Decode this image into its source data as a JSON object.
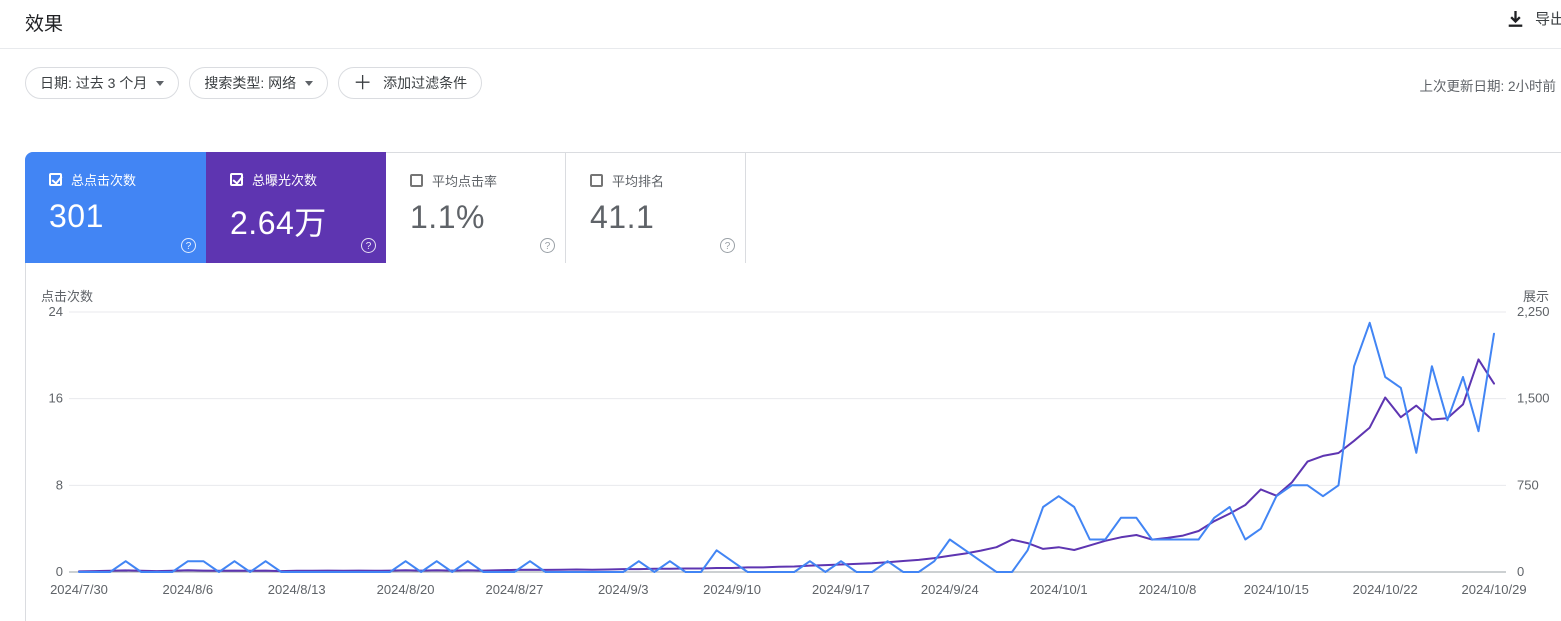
{
  "header": {
    "title": "效果",
    "export_label": "导出"
  },
  "filters": {
    "date_chip": "日期: 过去 3 个月",
    "search_type_chip": "搜索类型: 网络",
    "add_filter_chip": "添加过滤条件",
    "last_updated": "上次更新日期: 2小时前"
  },
  "cards": [
    {
      "label": "总点击次数",
      "value": "301",
      "checked": true,
      "color": "#4285f4"
    },
    {
      "label": "总曝光次数",
      "value": "2.64万",
      "checked": true,
      "color": "#5e35b1"
    },
    {
      "label": "平均点击率",
      "value": "1.1%",
      "checked": false,
      "color": "#ffffff"
    },
    {
      "label": "平均排名",
      "value": "41.1",
      "checked": false,
      "color": "#ffffff"
    }
  ],
  "chart_data": {
    "type": "line",
    "grid": true,
    "legend_position": "none",
    "y_left": {
      "label": "点击次数",
      "max": 24,
      "ticks": [
        {
          "label": "0",
          "value": 0
        },
        {
          "label": "8",
          "value": 8
        },
        {
          "label": "16",
          "value": 16
        },
        {
          "label": "24",
          "value": 24
        }
      ]
    },
    "y_right": {
      "label": "展示",
      "max": 2250,
      "ticks": [
        {
          "label": "0",
          "value": 0
        },
        {
          "label": "750",
          "value": 750
        },
        {
          "label": "1,500",
          "value": 1500
        },
        {
          "label": "2,250",
          "value": 2250
        }
      ]
    },
    "x_tick_labels": [
      "2024/7/30",
      "2024/8/6",
      "2024/8/13",
      "2024/8/20",
      "2024/8/27",
      "2024/9/3",
      "2024/9/10",
      "2024/9/17",
      "2024/9/24",
      "2024/10/1",
      "2024/10/8",
      "2024/10/15",
      "2024/10/22",
      "2024/10/29"
    ],
    "dates": [
      "2024/7/30",
      "2024/7/31",
      "2024/8/1",
      "2024/8/2",
      "2024/8/3",
      "2024/8/4",
      "2024/8/5",
      "2024/8/6",
      "2024/8/7",
      "2024/8/8",
      "2024/8/9",
      "2024/8/10",
      "2024/8/11",
      "2024/8/12",
      "2024/8/13",
      "2024/8/14",
      "2024/8/15",
      "2024/8/16",
      "2024/8/17",
      "2024/8/18",
      "2024/8/19",
      "2024/8/20",
      "2024/8/21",
      "2024/8/22",
      "2024/8/23",
      "2024/8/24",
      "2024/8/25",
      "2024/8/26",
      "2024/8/27",
      "2024/8/28",
      "2024/8/29",
      "2024/8/30",
      "2024/8/31",
      "2024/9/1",
      "2024/9/2",
      "2024/9/3",
      "2024/9/4",
      "2024/9/5",
      "2024/9/6",
      "2024/9/7",
      "2024/9/8",
      "2024/9/9",
      "2024/9/10",
      "2024/9/11",
      "2024/9/12",
      "2024/9/13",
      "2024/9/14",
      "2024/9/15",
      "2024/9/16",
      "2024/9/17",
      "2024/9/18",
      "2024/9/19",
      "2024/9/20",
      "2024/9/21",
      "2024/9/22",
      "2024/9/23",
      "2024/9/24",
      "2024/9/25",
      "2024/9/26",
      "2024/9/27",
      "2024/9/28",
      "2024/9/29",
      "2024/9/30",
      "2024/10/1",
      "2024/10/2",
      "2024/10/3",
      "2024/10/4",
      "2024/10/5",
      "2024/10/6",
      "2024/10/7",
      "2024/10/8",
      "2024/10/9",
      "2024/10/10",
      "2024/10/11",
      "2024/10/12",
      "2024/10/13",
      "2024/10/14",
      "2024/10/15",
      "2024/10/16",
      "2024/10/17",
      "2024/10/18",
      "2024/10/19",
      "2024/10/20",
      "2024/10/21",
      "2024/10/22",
      "2024/10/23",
      "2024/10/24",
      "2024/10/25",
      "2024/10/26",
      "2024/10/27",
      "2024/10/28",
      "2024/10/29"
    ],
    "series": [
      {
        "name": "点击次数",
        "axis": "left",
        "color": "#4285f4",
        "values": [
          0,
          0,
          0,
          1,
          0,
          0,
          0,
          1,
          1,
          0,
          1,
          0,
          1,
          0,
          0,
          0,
          0,
          0,
          0,
          0,
          0,
          1,
          0,
          1,
          0,
          1,
          0,
          0,
          0,
          1,
          0,
          0,
          0,
          0,
          0,
          0,
          1,
          0,
          1,
          0,
          0,
          2,
          1,
          0,
          0,
          0,
          0,
          1,
          0,
          1,
          0,
          0,
          1,
          0,
          0,
          1,
          3,
          2,
          1,
          0,
          0,
          2,
          6,
          7,
          6,
          3,
          3,
          5,
          5,
          3,
          3,
          3,
          3,
          5,
          6,
          3,
          4,
          7,
          8,
          8,
          7,
          8,
          19,
          23,
          18,
          17,
          11,
          19,
          14,
          18,
          13,
          22
        ]
      },
      {
        "name": "展示",
        "axis": "right",
        "color": "#5e35b1",
        "values": [
          5,
          8,
          10,
          14,
          10,
          8,
          10,
          15,
          12,
          10,
          12,
          10,
          12,
          8,
          10,
          10,
          12,
          10,
          12,
          10,
          12,
          15,
          12,
          15,
          12,
          15,
          12,
          15,
          18,
          20,
          18,
          20,
          22,
          20,
          22,
          25,
          25,
          28,
          28,
          30,
          30,
          35,
          35,
          40,
          40,
          45,
          48,
          55,
          60,
          65,
          70,
          75,
          85,
          95,
          105,
          120,
          140,
          160,
          185,
          215,
          280,
          250,
          200,
          215,
          190,
          230,
          270,
          300,
          320,
          280,
          295,
          315,
          355,
          440,
          505,
          580,
          715,
          660,
          775,
          955,
          1005,
          1030,
          1135,
          1250,
          1510,
          1340,
          1440,
          1320,
          1330,
          1450,
          1840,
          1630
        ]
      }
    ]
  }
}
